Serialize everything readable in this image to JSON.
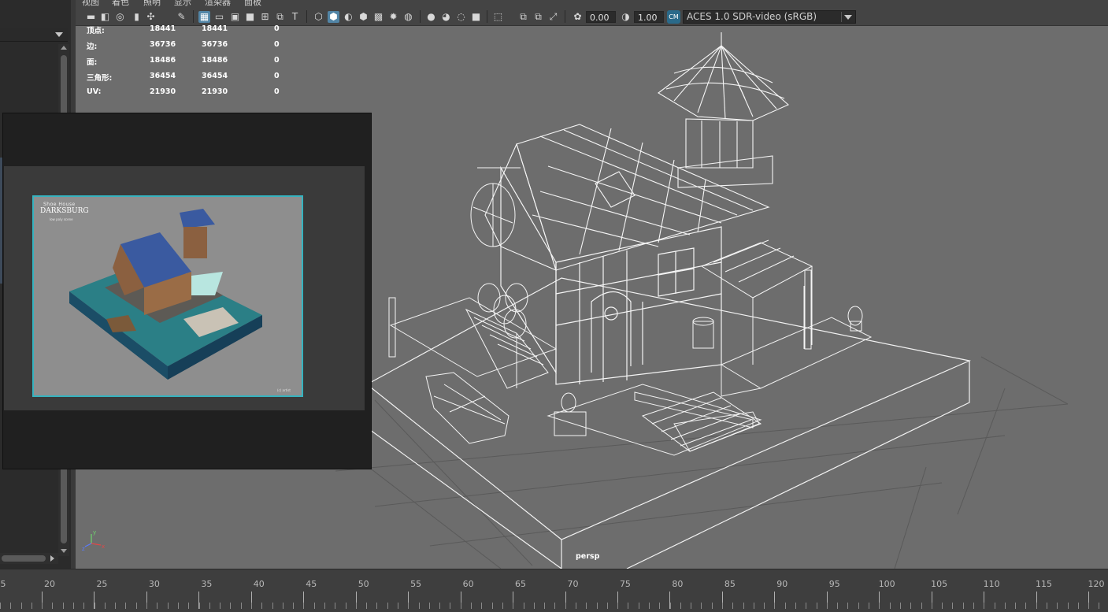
{
  "menu": {
    "items": [
      "视图",
      "着色",
      "照明",
      "显示",
      "渲染器",
      "面板"
    ]
  },
  "toolbar": {
    "exposure_value": "0.00",
    "gamma_value": "1.00",
    "color_space": "ACES 1.0 SDR-video (sRGB)",
    "icons": [
      "camera-icon",
      "camera-attributes-icon",
      "bookmark-icon",
      "image-plane-icon",
      "grid-icon",
      "film-gate-icon",
      "resolution-gate-icon",
      "gate-mask-icon",
      "field-chart-icon",
      "safe-action-icon",
      "safe-title-icon",
      "wireframe-icon",
      "smooth-shade-icon",
      "shade-wire-icon",
      "default-material-icon",
      "textured-icon",
      "lights-icon",
      "shadows-icon",
      "ambient-occlusion-icon",
      "motion-blur-icon",
      "anti-alias-icon",
      "isolate-select-icon",
      "xray-icon",
      "xray-joints-icon",
      "xray-components-icon",
      "exposure-icon",
      "gamma-icon",
      "color-management-icon"
    ]
  },
  "hud": {
    "rows": [
      {
        "label": "顶点:",
        "v1": "18441",
        "v2": "18441",
        "v3": "0"
      },
      {
        "label": "边:",
        "v1": "36736",
        "v2": "36736",
        "v3": "0"
      },
      {
        "label": "面:",
        "v1": "18486",
        "v2": "18486",
        "v3": "0"
      },
      {
        "label": "三角形:",
        "v1": "36454",
        "v2": "36454",
        "v3": "0"
      },
      {
        "label": "UV:",
        "v1": "21930",
        "v2": "21930",
        "v3": "0"
      }
    ]
  },
  "viewport": {
    "camera_label": "persp",
    "axis_labels": {
      "x": "x",
      "y": "y",
      "z": "z"
    }
  },
  "reference_image": {
    "title": "Shoe House",
    "logo": "DARKSBURG",
    "subtitle": "low poly scene",
    "credit": "(c) artist"
  },
  "timeline": {
    "labels": [
      "5",
      "20",
      "25",
      "30",
      "35",
      "40",
      "45",
      "50",
      "55",
      "60",
      "65",
      "70",
      "75",
      "80",
      "85",
      "90",
      "95",
      "100",
      "105",
      "110",
      "115",
      "120"
    ]
  }
}
